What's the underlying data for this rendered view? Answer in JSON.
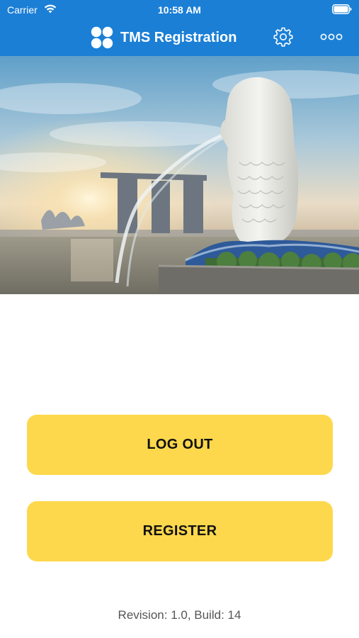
{
  "status_bar": {
    "carrier": "Carrier",
    "time": "10:58 AM",
    "wifi_icon": "wifi-icon",
    "battery_icon": "battery-full-icon"
  },
  "nav": {
    "title": "TMS Registration",
    "logo_icon": "four-dots-logo-icon",
    "settings_icon": "gear-icon",
    "more_icon": "more-horizontal-icon"
  },
  "hero": {
    "image": "Singapore Merlion statue with Marina Bay Sands skyline at sunrise"
  },
  "buttons": {
    "logout_label": "LOG OUT",
    "register_label": "REGISTER"
  },
  "footer": {
    "revision_text": "Revision: 1.0, Build: 14"
  },
  "colors": {
    "header_bg": "#1b7fd6",
    "button_bg": "#fed84c",
    "footer_text": "#555555"
  }
}
